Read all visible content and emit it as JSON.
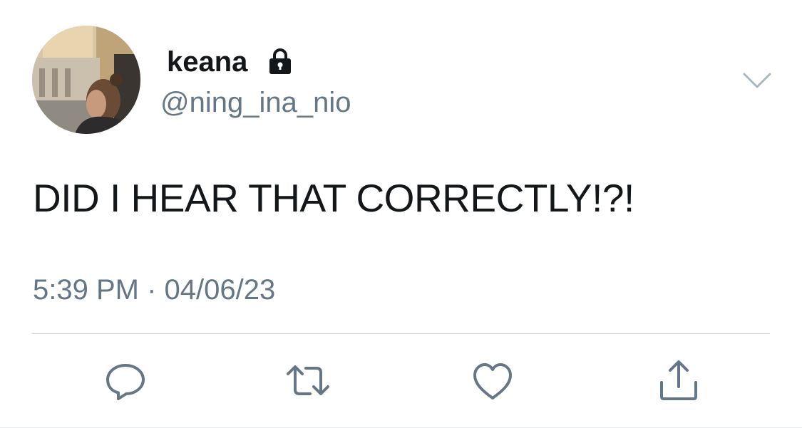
{
  "tweet": {
    "author": {
      "display_name": "keana",
      "handle": "@ning_ina_nio",
      "protected_icon": "lock-icon",
      "avatar_icon": "avatar-photo"
    },
    "text": "DID I HEAR THAT CORRECTLY!?!",
    "timestamp": "5:39 PM · 04/06/23"
  },
  "actions": [
    {
      "name": "reply",
      "icon": "speech-bubble-icon"
    },
    {
      "name": "retweet",
      "icon": "retweet-icon"
    },
    {
      "name": "like",
      "icon": "heart-icon"
    },
    {
      "name": "share",
      "icon": "share-icon"
    }
  ],
  "menu": {
    "icon": "chevron-down-icon"
  },
  "colors": {
    "text": "#14171a",
    "secondary": "#657786",
    "icon": "#657786",
    "divider": "#ccd6dd"
  }
}
